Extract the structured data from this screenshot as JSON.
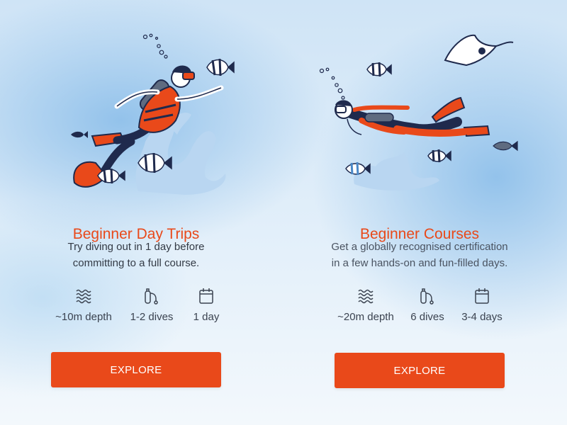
{
  "cards": [
    {
      "title": "Beginner Day Trips",
      "description_lines": [
        "Try diving out in 1 day before",
        "committing to a full course."
      ],
      "stats": [
        {
          "icon": "waves-icon",
          "label": "~10m depth"
        },
        {
          "icon": "oxygen-tank-icon",
          "label": "1-2 dives"
        },
        {
          "icon": "calendar-icon",
          "label": "1 day"
        }
      ],
      "button_label": "EXPLORE"
    },
    {
      "title": "Beginner Courses",
      "description_lines": [
        "Get a globally recognised certification",
        "in a few hands-on and fun-filled days."
      ],
      "stats": [
        {
          "icon": "waves-icon",
          "label": "~20m depth"
        },
        {
          "icon": "oxygen-tank-icon",
          "label": "6 dives"
        },
        {
          "icon": "calendar-icon",
          "label": "3-4 days"
        }
      ],
      "button_label": "EXPLORE"
    }
  ],
  "colors": {
    "accent": "#e9491a",
    "navy": "#1f2a4d",
    "sky": "#8fc0ea",
    "coral": "#b8d6f2"
  }
}
